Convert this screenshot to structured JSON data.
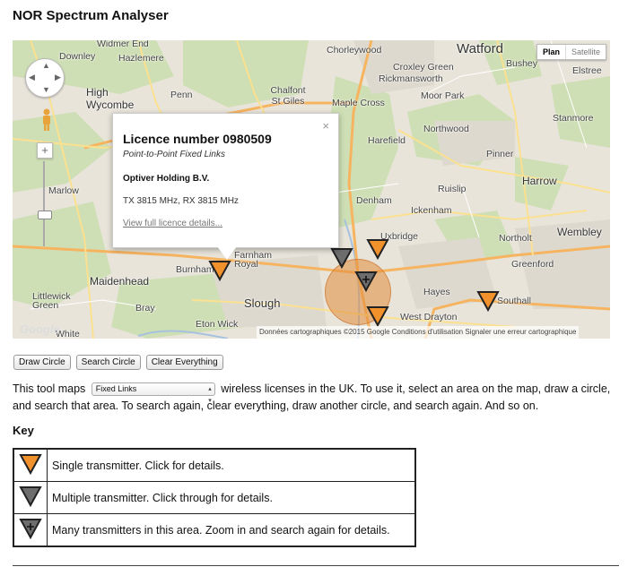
{
  "title": "NOR Spectrum Analyser",
  "map": {
    "type_plan": "Plan",
    "type_satellite": "Satellite",
    "attribution": "Données cartographiques ©2015 Google   Conditions d'utilisation   Signaler une erreur cartographique",
    "google": "Google",
    "places": [
      {
        "name": "Widmer End",
        "cls": ""
      },
      {
        "name": "Downley",
        "cls": ""
      },
      {
        "name": "Hazlemere",
        "cls": ""
      },
      {
        "name": "Chorleywood",
        "cls": ""
      },
      {
        "name": "Watford",
        "cls": "big"
      },
      {
        "name": "Bushey",
        "cls": ""
      },
      {
        "name": "Elstree",
        "cls": ""
      },
      {
        "name": "Croxley Green",
        "cls": ""
      },
      {
        "name": "Rickmansworth",
        "cls": ""
      },
      {
        "name": "Moor Park",
        "cls": ""
      },
      {
        "name": "High Wycombe",
        "cls": "big"
      },
      {
        "name": "Penn",
        "cls": ""
      },
      {
        "name": "Chalfont St Giles",
        "cls": ""
      },
      {
        "name": "Maple Cross",
        "cls": ""
      },
      {
        "name": "Stanmore",
        "cls": ""
      },
      {
        "name": "Northwood",
        "cls": ""
      },
      {
        "name": "Harefield",
        "cls": ""
      },
      {
        "name": "Pinner",
        "cls": ""
      },
      {
        "name": "Marlow",
        "cls": ""
      },
      {
        "name": "Harrow",
        "cls": "big"
      },
      {
        "name": "Ruislip",
        "cls": ""
      },
      {
        "name": "Denham",
        "cls": ""
      },
      {
        "name": "Ickenham",
        "cls": ""
      },
      {
        "name": "Uxbridge",
        "cls": ""
      },
      {
        "name": "Wembley",
        "cls": "big"
      },
      {
        "name": "Northolt",
        "cls": ""
      },
      {
        "name": "Greenford",
        "cls": ""
      },
      {
        "name": "Burnham",
        "cls": ""
      },
      {
        "name": "Maidenhead",
        "cls": "big"
      },
      {
        "name": "Slough",
        "cls": "big"
      },
      {
        "name": "Hayes",
        "cls": ""
      },
      {
        "name": "Bray",
        "cls": ""
      },
      {
        "name": "Eton Wick",
        "cls": ""
      },
      {
        "name": "West Drayton",
        "cls": ""
      },
      {
        "name": "Southall",
        "cls": ""
      },
      {
        "name": "Littlewick Green",
        "cls": ""
      },
      {
        "name": "Farnham Royal",
        "cls": ""
      },
      {
        "name": "White",
        "cls": ""
      }
    ],
    "infowindow": {
      "title": "Licence number 0980509",
      "subtitle": "Point-to-Point Fixed Links",
      "holder": "Optiver Holding B.V.",
      "frequency": "TX 3815 MHz, RX 3815 MHz",
      "link": "View full licence details...",
      "close": "×"
    }
  },
  "buttons": {
    "draw": "Draw Circle",
    "search": "Search Circle",
    "clear": "Clear Everything"
  },
  "description": {
    "before": "This tool maps",
    "select_value": "Fixed Links",
    "after": "wireless licenses in the UK. To use it, select an area on the map, draw a circle, and search that area. To search again, clear everything, draw another circle, and search again. And so on."
  },
  "key": {
    "title": "Key",
    "rows": [
      {
        "icon": "orange-triangle-icon",
        "color": "#f0912c",
        "text": "Single transmitter. Click for details."
      },
      {
        "icon": "grey-triangle-icon",
        "color": "#6d6d6d",
        "text": "Multiple transmitter. Click through for details."
      },
      {
        "icon": "grey-plus-triangle-icon",
        "color": "#6d6d6d",
        "text": "Many transmitters in this area. Zoom in and search again for details."
      }
    ]
  },
  "colors": {
    "orange_marker": "#f0912c",
    "grey_marker": "#6d6d6d",
    "circle_fill": "#e28c3c"
  }
}
